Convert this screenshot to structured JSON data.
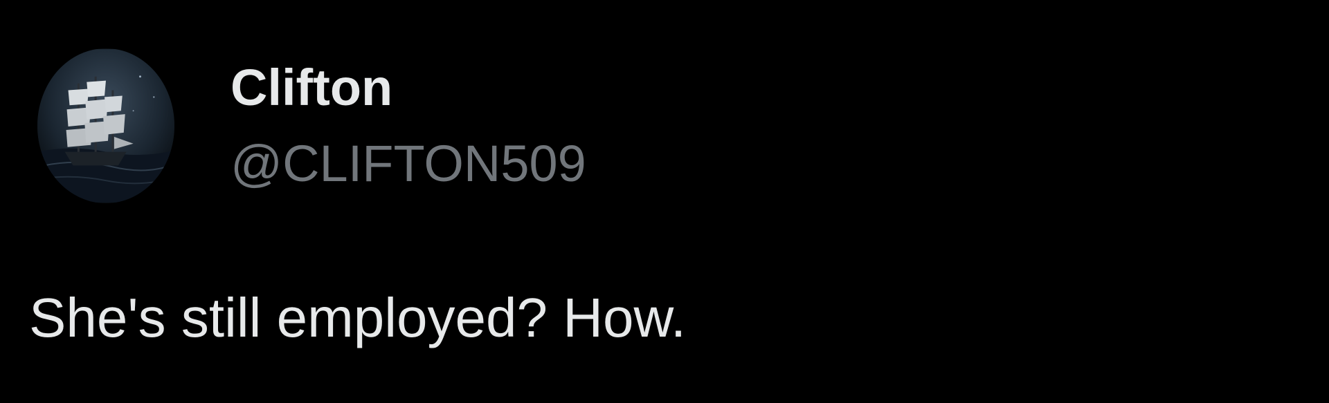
{
  "post": {
    "author": {
      "display_name": "Clifton",
      "handle": "@CLIFTON509",
      "avatar_icon": "sailing-ship-avatar"
    },
    "text": "She's still employed? How."
  },
  "colors": {
    "background": "#000000",
    "primary_text": "#e7e9ea",
    "secondary_text": "#71767b"
  }
}
